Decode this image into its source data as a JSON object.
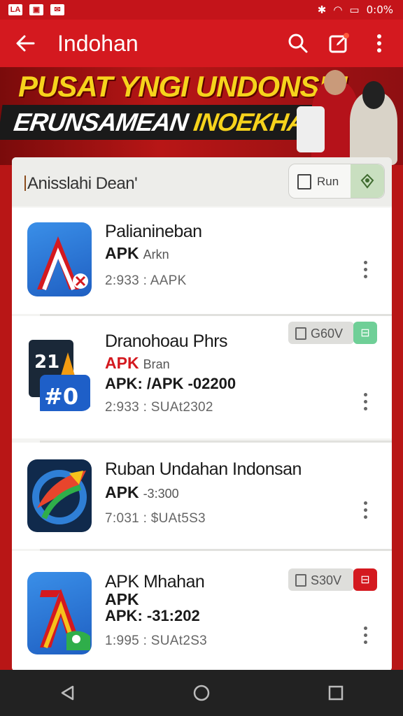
{
  "status_bar": {
    "left_icons": [
      "LA",
      "image-icon",
      "mail-icon"
    ],
    "right_text": "0:0%",
    "right_icons": [
      "bluetooth-icon",
      "wifi-icon",
      "battery-icon"
    ]
  },
  "app_bar": {
    "title": "Indohan",
    "icons": [
      "back-arrow-icon",
      "search-icon",
      "edit-icon",
      "more-vert-icon"
    ],
    "accent": "#d4191f"
  },
  "banner": {
    "line1": "PUSAT YNGI UNDONSIN",
    "line2_a": "ERUNSAMEAN",
    "line2_b": "INOEKHAN"
  },
  "search": {
    "query": "Anisslahi Dean'",
    "chip_label": "Run"
  },
  "apps": [
    {
      "name": "Palianineban",
      "line2_main": "APK",
      "line2_sub": "Arkn",
      "line3": "",
      "meta": "2:933 : AAPK",
      "badge": "",
      "icon": "red-a-icon"
    },
    {
      "name": "Dranohoau Phrs",
      "line2_main": "APK",
      "line2_sub": "Bran",
      "line3": "APK: /APK -02200",
      "meta": "2:933 : SUAt2302",
      "badge": "G60V",
      "icon": "a-40-icon"
    },
    {
      "name": "Ruban Undahan Indonsan",
      "line2_main": "APK",
      "line2_sub": "-3:300",
      "line3": "",
      "meta": "7:031 : $UAt5S3",
      "badge": "",
      "icon": "swirl-arrow-icon"
    },
    {
      "name": "APK Mhahan",
      "line2_main": "APK",
      "line2_sub": "",
      "line3": "APK: -31:202",
      "meta": "1:995 : SUAt2S3",
      "badge": "S30V",
      "icon": "flag-a-icon"
    }
  ]
}
